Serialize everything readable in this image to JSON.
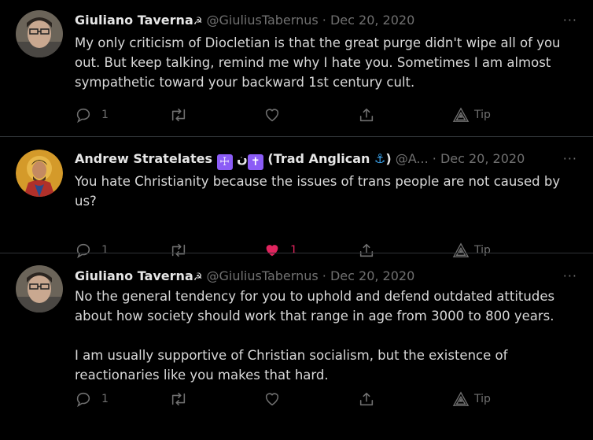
{
  "tweets": [
    {
      "name": "Giuliano Taverna",
      "name_emoji": "☭",
      "handle": "@GiuliusTabernus",
      "sep": "·",
      "date": "Dec 20, 2020",
      "more": "···",
      "text_lines": [
        "My only criticism of Diocletian is that the great purge didn't wipe all of you out. But keep talking, remind me why I hate you. Sometimes I am almost sympathetic toward your backward 1st century cult."
      ],
      "reply_count": "1",
      "like_count": "",
      "tip_label": "Tip"
    },
    {
      "name": "Andrew Stratelates",
      "name_badge1": "☩",
      "name_arabic": "ن",
      "name_badge2": "✝",
      "name_suffix": "(Trad Anglican",
      "name_anchor": "⚓",
      "name_close": ")",
      "handle": "@A...",
      "sep": "·",
      "date": "Dec 20, 2020",
      "more": "···",
      "text_lines": [
        "You hate Christianity because the issues of trans people are not caused by us?"
      ],
      "reply_count": "1",
      "like_count": "1",
      "tip_label": "Tip"
    },
    {
      "name": "Giuliano Taverna",
      "name_emoji": "☭",
      "handle": "@GiuliusTabernus",
      "sep": "·",
      "date": "Dec 20, 2020",
      "more": "···",
      "text_lines": [
        "No the general tendency for you to uphold and defend outdated attitudes about how society should work that range in age from 3000 to 800 years.",
        "I am usually supportive of Christian socialism, but the existence of reactionaries like you makes that hard."
      ],
      "reply_count": "1",
      "like_count": "",
      "tip_label": "Tip"
    }
  ],
  "colors": {
    "like_active": "#e0245e",
    "muted": "#707070",
    "divider": "#2f3336"
  }
}
